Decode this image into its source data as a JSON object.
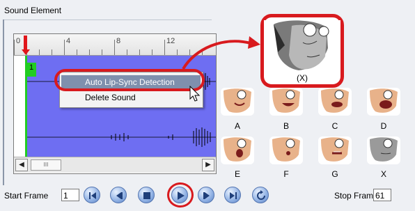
{
  "panel": {
    "title": "Sound Element"
  },
  "timeline": {
    "ruler_labels": [
      "0",
      "4",
      "8",
      "12"
    ],
    "frame_number": "1"
  },
  "context_menu": {
    "items": [
      {
        "label": "Auto Lip-Sync Detection",
        "highlighted": true
      },
      {
        "label": "Delete Sound",
        "highlighted": false
      }
    ]
  },
  "mouth_preview": {
    "label": "(X)"
  },
  "mouth_shapes": [
    "A",
    "B",
    "C",
    "D",
    "E",
    "F",
    "G",
    "X"
  ],
  "controls": {
    "start_frame_label": "Start Frame",
    "start_frame_value": "1",
    "stop_frame_label": "Stop Frame",
    "stop_frame_value": "61",
    "buttons": [
      "go-to-first-frame",
      "previous-frame",
      "stop",
      "play",
      "next-frame",
      "go-to-last-frame",
      "loop"
    ]
  },
  "scrollbar": {
    "thumb_grip": "III"
  },
  "colors": {
    "highlight_red": "#d81a1e",
    "track_blue": "#6e6ef2",
    "frame_green": "#22cc22",
    "menu_selection": "#7f90ad"
  }
}
